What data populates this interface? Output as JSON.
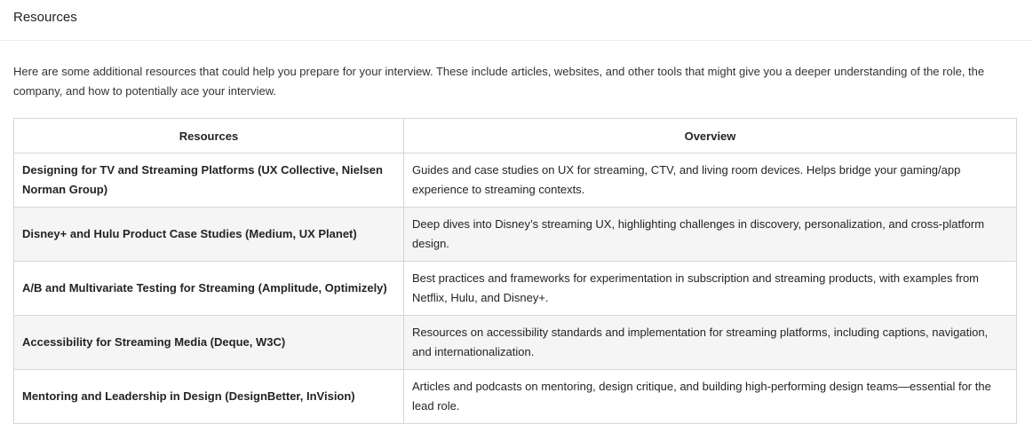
{
  "header": {
    "title": "Resources"
  },
  "intro": "Here are some additional resources that could help you prepare for your interview. These include articles, websites, and other tools that might give you a deeper understanding of the role, the company, and how to potentially ace your interview.",
  "table": {
    "columns": [
      "Resources",
      "Overview"
    ],
    "rows": [
      {
        "resource": "Designing for TV and Streaming Platforms (UX Collective, Nielsen Norman Group)",
        "overview": "Guides and case studies on UX for streaming, CTV, and living room devices. Helps bridge your gaming/app experience to streaming contexts."
      },
      {
        "resource": "Disney+ and Hulu Product Case Studies (Medium, UX Planet)",
        "overview": "Deep dives into Disney’s streaming UX, highlighting challenges in discovery, personalization, and cross-platform design."
      },
      {
        "resource": "A/B and Multivariate Testing for Streaming (Amplitude, Optimizely)",
        "overview": "Best practices and frameworks for experimentation in subscription and streaming products, with examples from Netflix, Hulu, and Disney+."
      },
      {
        "resource": "Accessibility for Streaming Media (Deque, W3C)",
        "overview": "Resources on accessibility standards and implementation for streaming platforms, including captions, navigation, and internationalization."
      },
      {
        "resource": "Mentoring and Leadership in Design (DesignBetter, InVision)",
        "overview": "Articles and podcasts on mentoring, design critique, and building high-performing design teams—essential for the lead role."
      }
    ]
  }
}
